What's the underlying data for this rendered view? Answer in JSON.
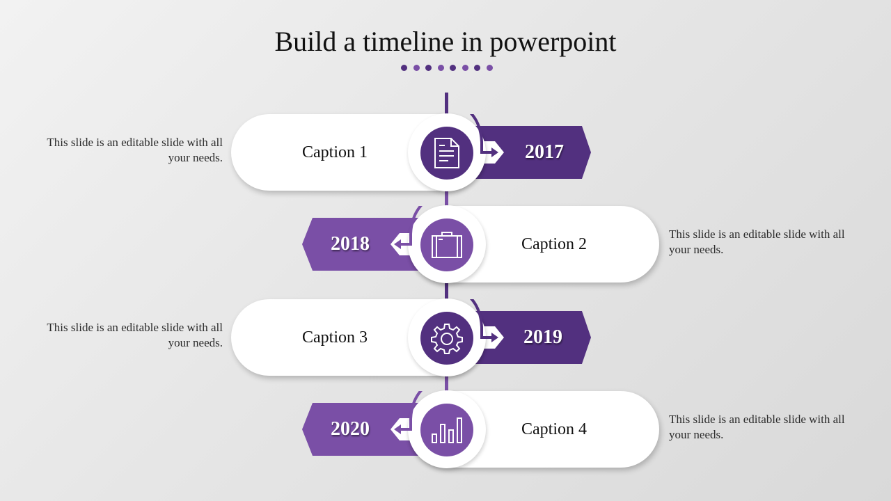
{
  "title": "Build a timeline in powerpoint",
  "colors": {
    "dark_purple": "#52307f",
    "light_purple": "#7a4fa6",
    "background": "#e6e6e6",
    "card": "#ffffff"
  },
  "title_dots": [
    "#52307f",
    "#7a4fa6",
    "#52307f",
    "#7a4fa6",
    "#52307f",
    "#7a4fa6",
    "#52307f",
    "#7a4fa6"
  ],
  "timeline": [
    {
      "caption": "Caption 1",
      "year": "2017",
      "icon": "document-icon",
      "side": "left-card",
      "description": "This slide is an editable slide with all your needs."
    },
    {
      "caption": "Caption 2",
      "year": "2018",
      "icon": "briefcase-icon",
      "side": "right-card",
      "description": "This slide is an editable slide with all your needs."
    },
    {
      "caption": "Caption 3",
      "year": "2019",
      "icon": "gear-icon",
      "side": "left-card",
      "description": "This slide is an editable slide with all your needs."
    },
    {
      "caption": "Caption 4",
      "year": "2020",
      "icon": "bar-chart-icon",
      "side": "right-card",
      "description": "This slide is an editable slide with all your needs."
    }
  ]
}
